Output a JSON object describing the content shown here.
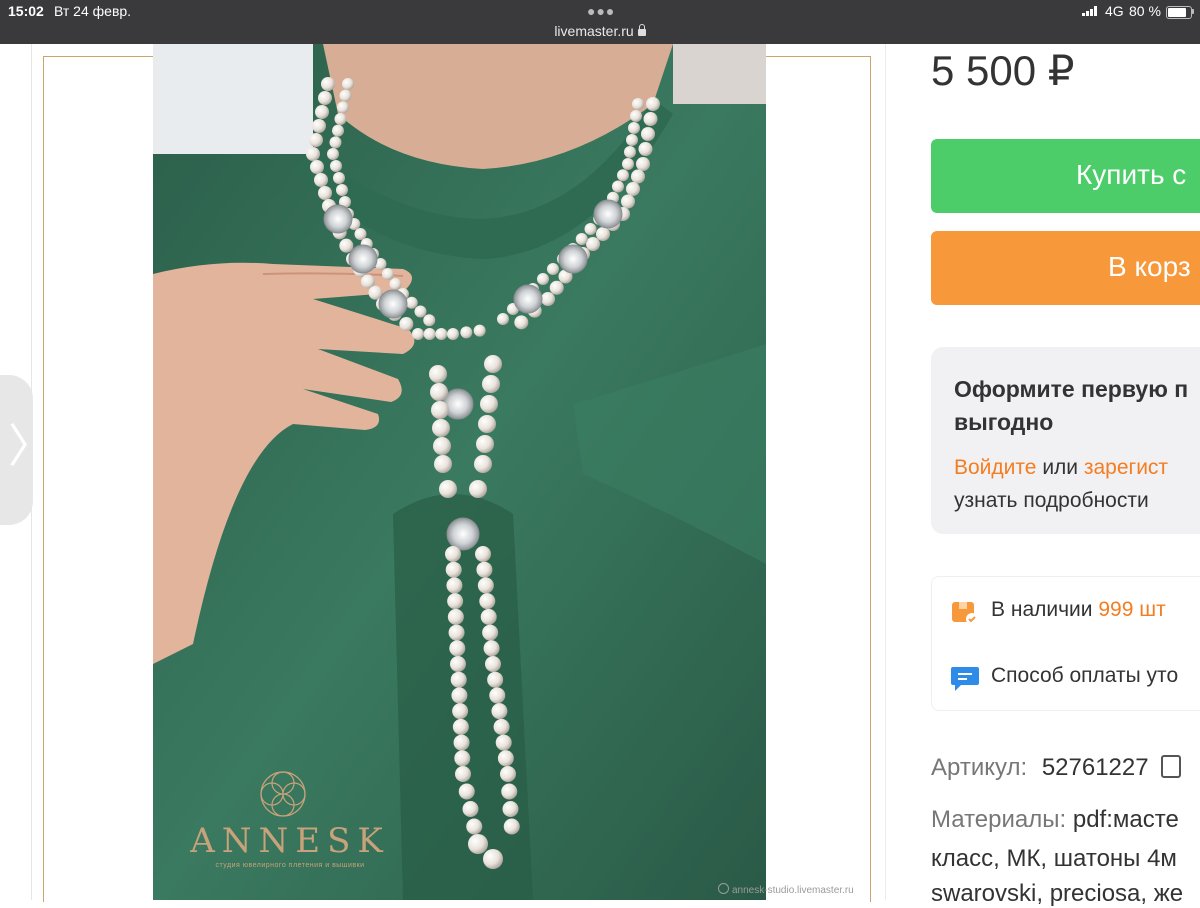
{
  "status_bar": {
    "time": "15:02",
    "date": "Вт 24 февр.",
    "url": "livemaster.ru",
    "network": "4G",
    "battery": "80 %",
    "battery_level_pct": 80
  },
  "product_image": {
    "brand": "ANNESK",
    "brand_subtitle": "студия ювелирного плетения и вышивки",
    "watermark": "annesk-studio.livemaster.ru"
  },
  "side_tab": {
    "icon": "chevron-right-icon"
  },
  "product": {
    "price": "5 500 ₽",
    "buy_label": "Купить с",
    "cart_label": "В корз"
  },
  "promo": {
    "title_line1": "Оформите первую п",
    "title_line2": "выгодно",
    "login_link": "Войдите",
    "or_text": "или",
    "register_link": "зарегист",
    "details_text": "узнать подробности"
  },
  "stock": {
    "icon": "box-icon",
    "label": "В наличии",
    "quantity": "999 шт"
  },
  "payment": {
    "icon": "chat-icon",
    "label": "Способ оплаты уто"
  },
  "attributes": {
    "article_label": "Артикул:",
    "article_value": "52761227",
    "materials_label": "Материалы:",
    "materials_line1": "pdf:масте",
    "materials_line2": "класс, МК, шатоны 4м",
    "materials_line3": "swarovski, preciosa, же"
  },
  "colors": {
    "buy_button": "#4ccd6a",
    "cart_button": "#f7983b",
    "accent_link": "#f47d20",
    "frame_gold": "#c9a66b"
  }
}
